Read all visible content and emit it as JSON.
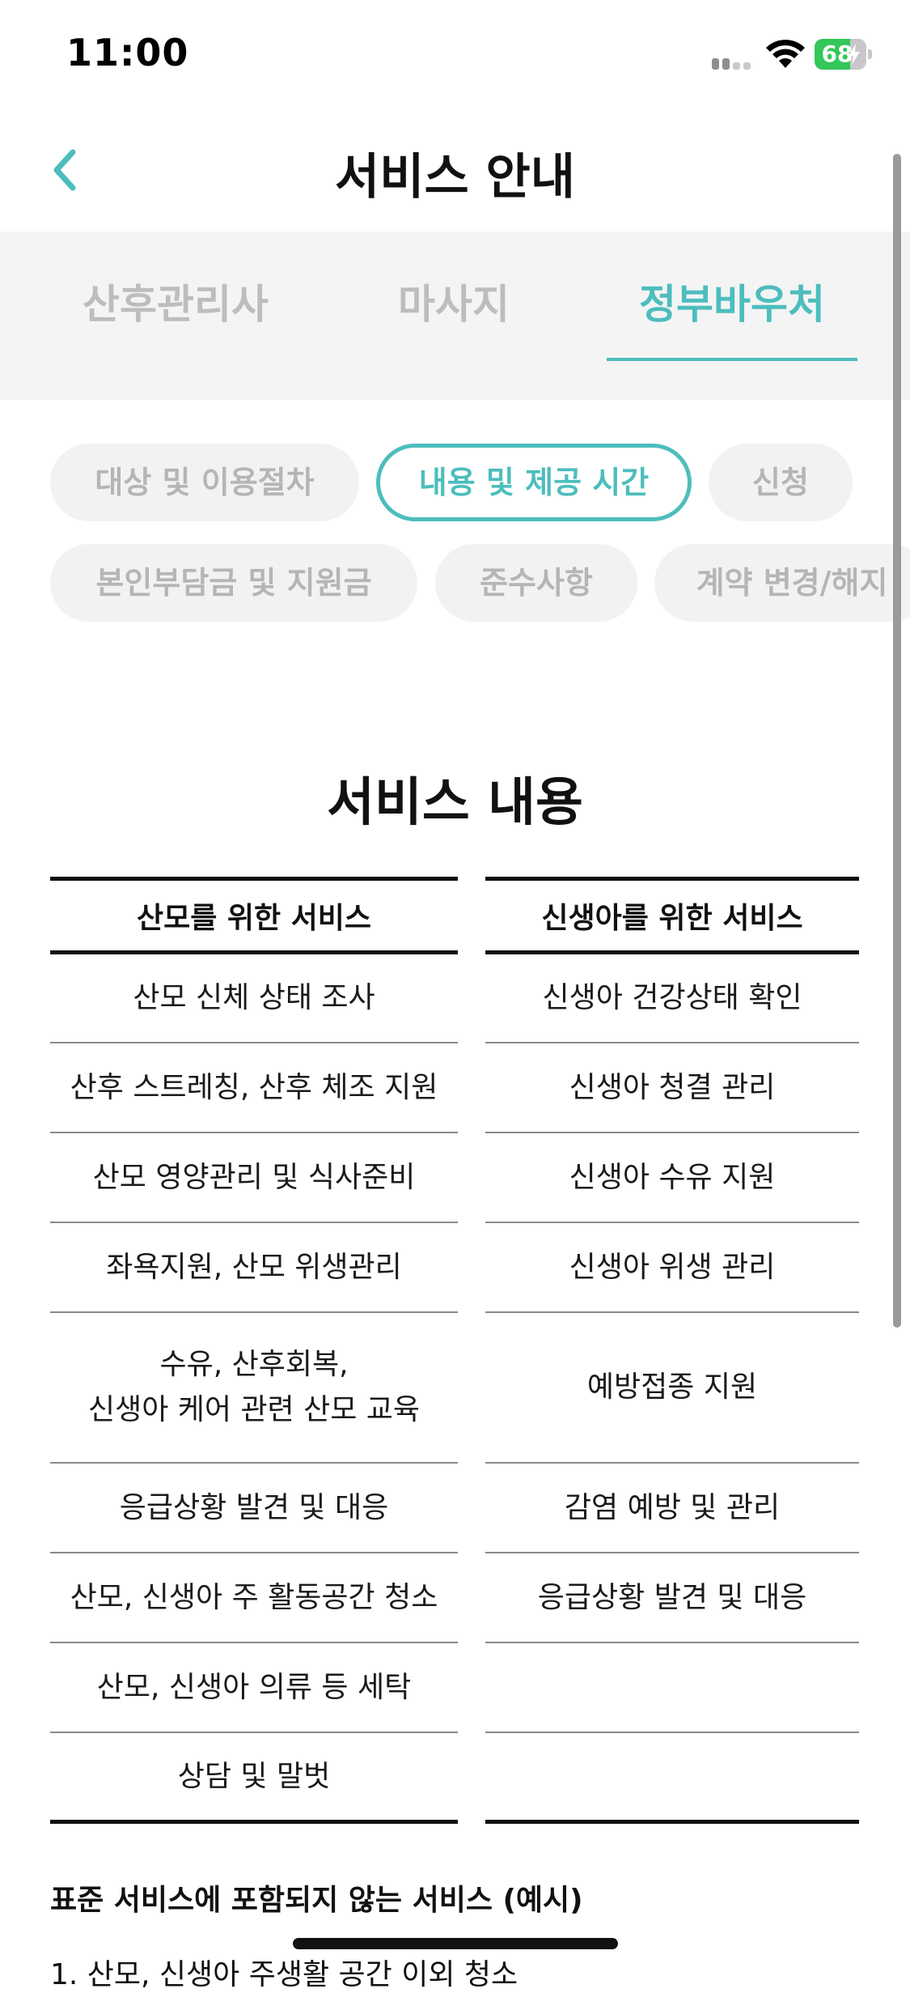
{
  "status_bar": {
    "time": "11:00",
    "battery_percent": "68",
    "battery_level": 0.68,
    "icons": [
      "signal-icon",
      "wifi-icon",
      "battery-icon",
      "charging-bolt-icon"
    ]
  },
  "nav": {
    "title": "서비스 안내",
    "back_icon": "chevron-left-icon"
  },
  "top_tabs": [
    {
      "label": "산후관리사",
      "active": false
    },
    {
      "label": "마사지",
      "active": false
    },
    {
      "label": "정부바우처",
      "active": true
    }
  ],
  "chips": [
    {
      "label": "대상 및 이용절차",
      "active": false
    },
    {
      "label": "내용 및 제공 시간",
      "active": true
    },
    {
      "label": "신청",
      "active": false
    },
    {
      "label": "본인부담금 및 지원금",
      "active": false
    },
    {
      "label": "준수사항",
      "active": false
    },
    {
      "label": "계약 변경/해지",
      "active": false
    }
  ],
  "section": {
    "title": "서비스 내용"
  },
  "table": {
    "headers": [
      "산모를 위한 서비스",
      "신생아를 위한 서비스"
    ],
    "rows": [
      [
        "산모 신체 상태 조사",
        "신생아 건강상태 확인"
      ],
      [
        "산후 스트레칭, 산후 체조 지원",
        "신생아 청결 관리"
      ],
      [
        "산모 영양관리 및 식사준비",
        "신생아 수유 지원"
      ],
      [
        "좌욕지원, 산모 위생관리",
        "신생아 위생 관리"
      ],
      [
        "수유, 산후회복,\n신생아 케어 관련 산모 교육",
        "예방접종 지원"
      ],
      [
        "응급상황 발견 및 대응",
        "감염 예방 및 관리"
      ],
      [
        "산모, 신생아 주 활동공간 청소",
        "응급상황 발견 및 대응"
      ],
      [
        "산모, 신생아 의류 등 세탁",
        ""
      ],
      [
        "상담 및 말벗",
        ""
      ]
    ]
  },
  "note": {
    "title": "표준 서비스에 포함되지 않는 서비스 (예시)",
    "first_item": "1. 산모, 신생아 주생활 공간 이외 청소"
  },
  "colors": {
    "accent": "#4dbdbd",
    "inactive_text": "#bdbdbd",
    "chip_bg": "#f2f2f2",
    "tab_bar_bg": "#f4f4f4"
  }
}
